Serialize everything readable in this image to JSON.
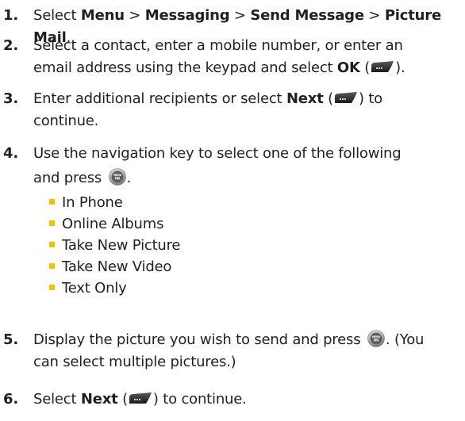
{
  "steps": [
    {
      "number": "1.",
      "parts": [
        "Select ",
        "Menu",
        " > ",
        "Messaging",
        " > ",
        "Send Message",
        " > ",
        "Picture Mail",
        "."
      ]
    },
    {
      "number": "2.",
      "line1": "Select a contact, enter a mobile number, or enter an",
      "line2_pre": "email address using the keypad and select ",
      "bold": "OK",
      "open": " (",
      "close": ")."
    },
    {
      "number": "3.",
      "pre": "Enter additional recipients or select ",
      "bold": "Next",
      "open": " (",
      "close": ") to",
      "line2": "continue."
    },
    {
      "number": "4.",
      "line1": "Use the navigation key to select one of the following",
      "line2_pre": "and press ",
      "line2_post": ".",
      "options": [
        "In Phone",
        "Online Albums",
        "Take New Picture",
        "Take New Video",
        "Text Only"
      ]
    },
    {
      "number": "5.",
      "line1_pre": "Display the picture you wish to send and press ",
      "line1_post": ". (You",
      "line2": "can select multiple pictures.)"
    },
    {
      "number": "6.",
      "pre": "Select ",
      "bold": "Next",
      "open": " (",
      "close": ") to continue."
    }
  ],
  "icons": {
    "softkey": "right-softkey-icon",
    "ok": "menu-ok-button-icon",
    "ok_label_top": "MENU",
    "ok_label_bottom": "OK",
    "bullet_color": "#f2c200",
    "text_color": "#231f20"
  }
}
